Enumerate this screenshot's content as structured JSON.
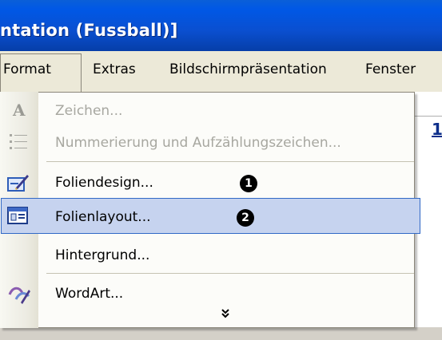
{
  "window": {
    "title": "ntation (Fussball)]"
  },
  "menubar": {
    "items": [
      "Format",
      "Extras",
      "Bildschirmpräsentation",
      "Fenster"
    ]
  },
  "dropdown": {
    "items": [
      {
        "label": "Zeichen...",
        "enabled": false,
        "icon": "font-a-icon"
      },
      {
        "label": "Nummerierung und Aufzählungszeichen...",
        "enabled": false,
        "icon": "bullet-list-icon"
      },
      {
        "label": "Foliendesign...",
        "enabled": true,
        "icon": "slide-design-icon",
        "marker": "1"
      },
      {
        "label": "Folienlayout...",
        "enabled": true,
        "icon": "slide-layout-icon",
        "marker": "2",
        "highlighted": true
      },
      {
        "label": "Hintergrund...",
        "enabled": true
      },
      {
        "label": "WordArt...",
        "enabled": true,
        "icon": "wordart-icon"
      }
    ],
    "expand_label": "»"
  },
  "document": {
    "visible_digit": "1"
  }
}
